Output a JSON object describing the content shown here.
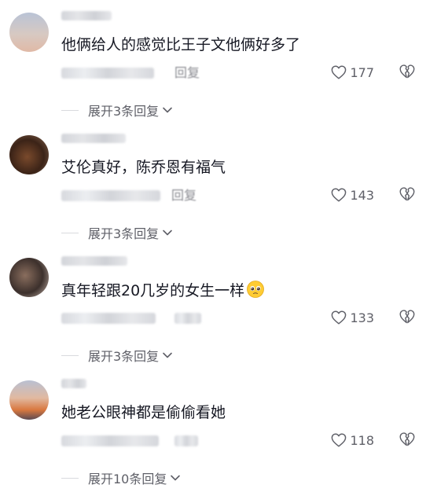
{
  "comments": [
    {
      "text": "他俩给人的感觉比王子文他俩好多了",
      "reply_label": "回复",
      "likes": "177",
      "expand_label": "展开3条回复"
    },
    {
      "text": "艾伦真好，陈乔恩有福气",
      "reply_label": "回复",
      "likes": "143",
      "expand_label": "展开3条回复"
    },
    {
      "text": "真年轻跟20几岁的女生一样",
      "reply_label": "",
      "likes": "133",
      "expand_label": "展开3条回复"
    },
    {
      "text": "她老公眼神都是偷偷看她",
      "reply_label": "",
      "likes": "118",
      "expand_label": "展开10条回复"
    }
  ],
  "icons": {
    "like": "heart-outline-icon",
    "dislike": "broken-heart-icon",
    "expand": "chevron-down-icon",
    "emoji": "pleading-face-emoji"
  },
  "colors": {
    "text": "#161823",
    "secondary": "#5f6068",
    "muted": "#8a8b91"
  }
}
